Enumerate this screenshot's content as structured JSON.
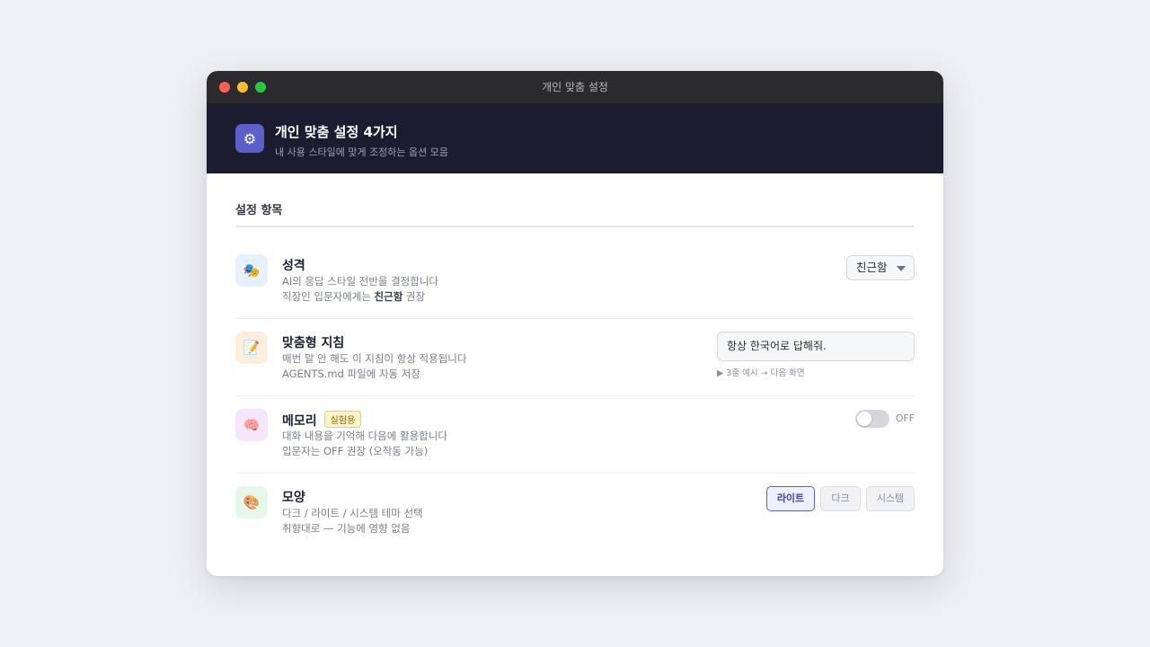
{
  "window": {
    "title": "개인 맞춤 설정"
  },
  "header": {
    "icon": "gear-icon",
    "icon_glyph": "⚙",
    "title": "개인 맞춤 설정 4가지",
    "subtitle": "내 사용 스타일에 맞게 조정하는 옵션 모음"
  },
  "section": {
    "title": "설정 항목"
  },
  "settings": {
    "personality": {
      "icon": "theater-masks-icon",
      "icon_glyph": "🎭",
      "title": "성격",
      "desc_line1": "AI의 응답 스타일 전반을 결정합니다",
      "desc_line2_prefix": "직장인 입문자에게는 ",
      "desc_line2_bold": "친근함",
      "desc_line2_suffix": " 권장",
      "select_value": "친근함"
    },
    "instructions": {
      "icon": "memo-icon",
      "icon_glyph": "📝",
      "title": "맞춤형 지침",
      "desc_line1": "매번 말 안 해도 이 지침이 항상 적용됩니다",
      "desc_line2": "AGENTS.md 파일에 자동 저장",
      "input_value": "항상 한국어로 답해줘.",
      "hint": "▶ 3줄 예시 → 다음 화면"
    },
    "memory": {
      "icon": "brain-icon",
      "icon_glyph": "🧠",
      "title": "메모리",
      "badge": "실험용",
      "desc_line1": "대화 내용을 기억해 다음에 활용합니다",
      "desc_line2": "입문자는 OFF 권장 (오작동 가능)",
      "toggle_state": "OFF"
    },
    "appearance": {
      "icon": "palette-icon",
      "icon_glyph": "🎨",
      "title": "모양",
      "desc_line1": "다크 / 라이트 / 시스템 테마 선택",
      "desc_line2": "취향대로 — 기능에 영향 없음",
      "options": [
        "라이트",
        "다크",
        "시스템"
      ],
      "selected": "라이트"
    }
  },
  "colors": {
    "accent": "#5b5fc7",
    "header_bg": "#1c1c30",
    "titlebar_bg": "#2b2b2d"
  }
}
